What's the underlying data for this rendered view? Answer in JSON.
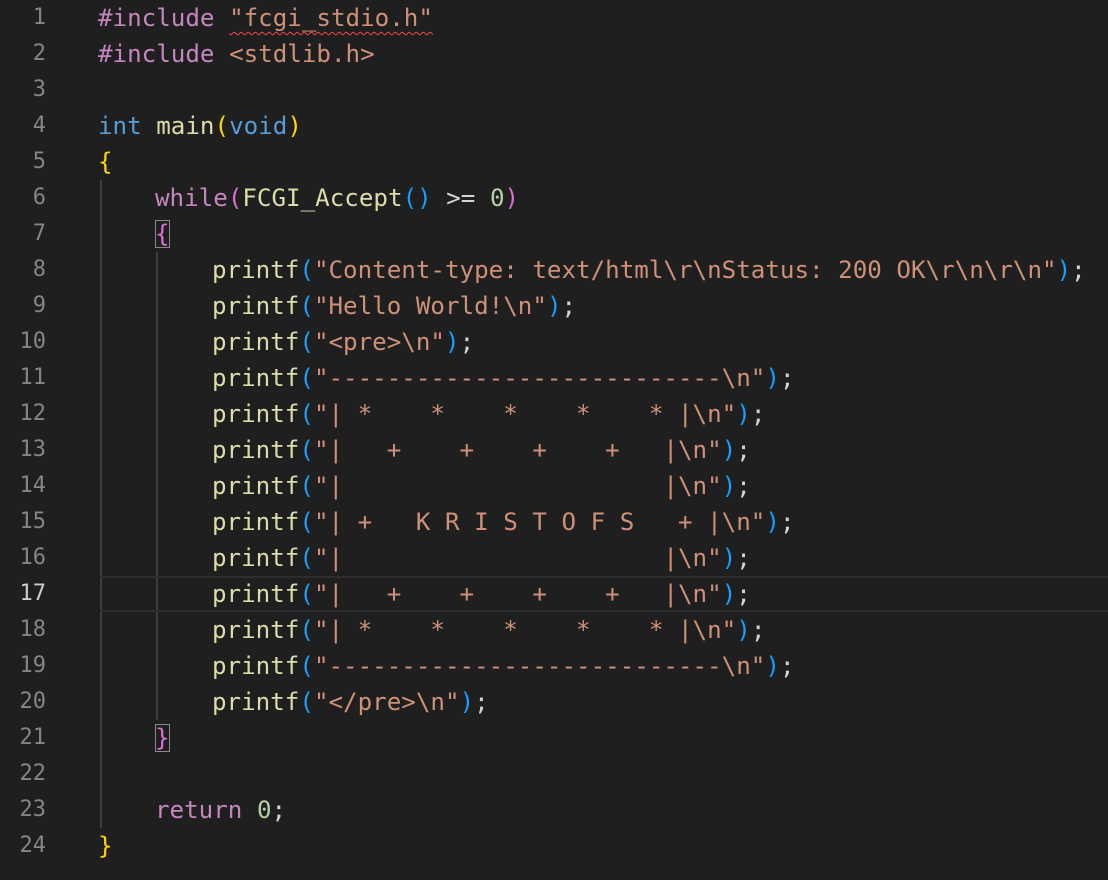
{
  "editor": {
    "active_line": 17,
    "colors": {
      "background": "#1f1f1f",
      "line_number": "#858585",
      "line_number_active": "#cccccc",
      "keyword_purple": "#c586c0",
      "keyword_blue": "#569cd6",
      "function": "#dcdcaa",
      "string": "#ce9178",
      "number": "#b5cea8",
      "text": "#d4d4d4",
      "bracket_gold": "#ffd700",
      "bracket_pink": "#da70d6",
      "bracket_blue": "#179fff",
      "error_squiggle": "#f14c4c"
    },
    "lines": [
      {
        "n": "1",
        "indent": 0,
        "tokens": [
          {
            "t": "#include",
            "c": "keyword_purple"
          },
          {
            "t": " ",
            "c": "text"
          },
          {
            "t": "\"fcgi_stdio.h\"",
            "c": "string",
            "squiggle": true
          }
        ]
      },
      {
        "n": "2",
        "indent": 0,
        "tokens": [
          {
            "t": "#include",
            "c": "keyword_purple"
          },
          {
            "t": " ",
            "c": "text"
          },
          {
            "t": "<stdlib.h>",
            "c": "string"
          }
        ]
      },
      {
        "n": "3",
        "indent": 0,
        "tokens": []
      },
      {
        "n": "4",
        "indent": 0,
        "tokens": [
          {
            "t": "int",
            "c": "keyword_blue"
          },
          {
            "t": " ",
            "c": "text"
          },
          {
            "t": "main",
            "c": "function"
          },
          {
            "t": "(",
            "c": "bracket_gold"
          },
          {
            "t": "void",
            "c": "keyword_blue"
          },
          {
            "t": ")",
            "c": "bracket_gold"
          }
        ]
      },
      {
        "n": "5",
        "indent": 0,
        "tokens": [
          {
            "t": "{",
            "c": "bracket_gold"
          }
        ]
      },
      {
        "n": "6",
        "indent": 1,
        "tokens": [
          {
            "t": "while",
            "c": "keyword_purple"
          },
          {
            "t": "(",
            "c": "bracket_pink"
          },
          {
            "t": "FCGI_Accept",
            "c": "function"
          },
          {
            "t": "()",
            "c": "bracket_blue"
          },
          {
            "t": " >= ",
            "c": "text"
          },
          {
            "t": "0",
            "c": "number"
          },
          {
            "t": ")",
            "c": "bracket_pink"
          }
        ]
      },
      {
        "n": "7",
        "indent": 1,
        "tokens": [
          {
            "t": "{",
            "c": "bracket_pink",
            "box": true
          }
        ]
      },
      {
        "n": "8",
        "indent": 2,
        "tokens": [
          {
            "t": "printf",
            "c": "function"
          },
          {
            "t": "(",
            "c": "bracket_blue"
          },
          {
            "t": "\"Content-type: text/html\\r\\nStatus: 200 OK\\r\\n\\r\\n\"",
            "c": "string"
          },
          {
            "t": ")",
            "c": "bracket_blue"
          },
          {
            "t": ";",
            "c": "text"
          }
        ]
      },
      {
        "n": "9",
        "indent": 2,
        "tokens": [
          {
            "t": "printf",
            "c": "function"
          },
          {
            "t": "(",
            "c": "bracket_blue"
          },
          {
            "t": "\"Hello World!\\n\"",
            "c": "string"
          },
          {
            "t": ")",
            "c": "bracket_blue"
          },
          {
            "t": ";",
            "c": "text"
          }
        ]
      },
      {
        "n": "10",
        "indent": 2,
        "tokens": [
          {
            "t": "printf",
            "c": "function"
          },
          {
            "t": "(",
            "c": "bracket_blue"
          },
          {
            "t": "\"<pre>\\n\"",
            "c": "string"
          },
          {
            "t": ")",
            "c": "bracket_blue"
          },
          {
            "t": ";",
            "c": "text"
          }
        ]
      },
      {
        "n": "11",
        "indent": 2,
        "tokens": [
          {
            "t": "printf",
            "c": "function"
          },
          {
            "t": "(",
            "c": "bracket_blue"
          },
          {
            "t": "\"---------------------------\\n\"",
            "c": "string"
          },
          {
            "t": ")",
            "c": "bracket_blue"
          },
          {
            "t": ";",
            "c": "text"
          }
        ]
      },
      {
        "n": "12",
        "indent": 2,
        "tokens": [
          {
            "t": "printf",
            "c": "function"
          },
          {
            "t": "(",
            "c": "bracket_blue"
          },
          {
            "t": "\"| *    *    *    *    * |\\n\"",
            "c": "string"
          },
          {
            "t": ")",
            "c": "bracket_blue"
          },
          {
            "t": ";",
            "c": "text"
          }
        ]
      },
      {
        "n": "13",
        "indent": 2,
        "tokens": [
          {
            "t": "printf",
            "c": "function"
          },
          {
            "t": "(",
            "c": "bracket_blue"
          },
          {
            "t": "\"|   +    +    +    +   |\\n\"",
            "c": "string"
          },
          {
            "t": ")",
            "c": "bracket_blue"
          },
          {
            "t": ";",
            "c": "text"
          }
        ]
      },
      {
        "n": "14",
        "indent": 2,
        "tokens": [
          {
            "t": "printf",
            "c": "function"
          },
          {
            "t": "(",
            "c": "bracket_blue"
          },
          {
            "t": "\"|                      |\\n\"",
            "c": "string"
          },
          {
            "t": ")",
            "c": "bracket_blue"
          },
          {
            "t": ";",
            "c": "text"
          }
        ]
      },
      {
        "n": "15",
        "indent": 2,
        "tokens": [
          {
            "t": "printf",
            "c": "function"
          },
          {
            "t": "(",
            "c": "bracket_blue"
          },
          {
            "t": "\"| +   K R I S T O F S   + |\\n\"",
            "c": "string"
          },
          {
            "t": ")",
            "c": "bracket_blue"
          },
          {
            "t": ";",
            "c": "text"
          }
        ]
      },
      {
        "n": "16",
        "indent": 2,
        "tokens": [
          {
            "t": "printf",
            "c": "function"
          },
          {
            "t": "(",
            "c": "bracket_blue"
          },
          {
            "t": "\"|                      |\\n\"",
            "c": "string"
          },
          {
            "t": ")",
            "c": "bracket_blue"
          },
          {
            "t": ";",
            "c": "text"
          }
        ]
      },
      {
        "n": "17",
        "indent": 2,
        "tokens": [
          {
            "t": "printf",
            "c": "function"
          },
          {
            "t": "(",
            "c": "bracket_blue"
          },
          {
            "t": "\"|   +    +    +    +   |\\n\"",
            "c": "string"
          },
          {
            "t": ")",
            "c": "bracket_blue"
          },
          {
            "t": ";",
            "c": "text"
          }
        ]
      },
      {
        "n": "18",
        "indent": 2,
        "tokens": [
          {
            "t": "printf",
            "c": "function"
          },
          {
            "t": "(",
            "c": "bracket_blue"
          },
          {
            "t": "\"| *    *    *    *    * |\\n\"",
            "c": "string"
          },
          {
            "t": ")",
            "c": "bracket_blue"
          },
          {
            "t": ";",
            "c": "text"
          }
        ]
      },
      {
        "n": "19",
        "indent": 2,
        "tokens": [
          {
            "t": "printf",
            "c": "function"
          },
          {
            "t": "(",
            "c": "bracket_blue"
          },
          {
            "t": "\"---------------------------\\n\"",
            "c": "string"
          },
          {
            "t": ")",
            "c": "bracket_blue"
          },
          {
            "t": ";",
            "c": "text"
          }
        ]
      },
      {
        "n": "20",
        "indent": 2,
        "tokens": [
          {
            "t": "printf",
            "c": "function"
          },
          {
            "t": "(",
            "c": "bracket_blue"
          },
          {
            "t": "\"</pre>\\n\"",
            "c": "string"
          },
          {
            "t": ")",
            "c": "bracket_blue"
          },
          {
            "t": ";",
            "c": "text"
          }
        ]
      },
      {
        "n": "21",
        "indent": 1,
        "tokens": [
          {
            "t": "}",
            "c": "bracket_pink",
            "box": true
          }
        ]
      },
      {
        "n": "22",
        "indent": 0,
        "tokens": []
      },
      {
        "n": "23",
        "indent": 1,
        "tokens": [
          {
            "t": "return",
            "c": "keyword_purple"
          },
          {
            "t": " ",
            "c": "text"
          },
          {
            "t": "0",
            "c": "number"
          },
          {
            "t": ";",
            "c": "text"
          }
        ]
      },
      {
        "n": "24",
        "indent": 0,
        "tokens": [
          {
            "t": "}",
            "c": "bracket_gold"
          }
        ]
      }
    ]
  }
}
